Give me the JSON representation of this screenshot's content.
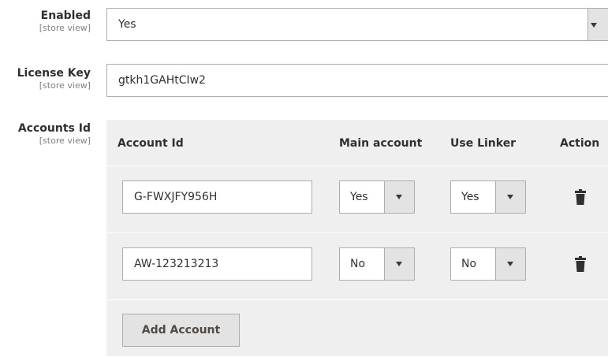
{
  "fields": {
    "enabled": {
      "label": "Enabled",
      "scope": "[store view]",
      "value": "Yes"
    },
    "license_key": {
      "label": "License Key",
      "scope": "[store view]",
      "value": "gtkh1GAHtCIw2"
    },
    "accounts_id": {
      "label": "Accounts Id",
      "scope": "[store view]"
    }
  },
  "grid": {
    "headers": {
      "account_id": "Account Id",
      "main_account": "Main account",
      "use_linker": "Use Linker",
      "action": "Action"
    },
    "rows": [
      {
        "account_id": "G-FWXJFY956H",
        "main_account": "Yes",
        "use_linker": "Yes",
        "action_icon": "trash-icon"
      },
      {
        "account_id": "AW-123213213",
        "main_account": "No",
        "use_linker": "No",
        "action_icon": "trash-icon"
      }
    ],
    "add_button_label": "Add Account"
  },
  "colors": {
    "text": "#303030",
    "muted": "#808080",
    "border": "#adadad",
    "grid_bg": "#efefef",
    "control_bg": "#e3e3e3",
    "button_text": "#514943"
  }
}
